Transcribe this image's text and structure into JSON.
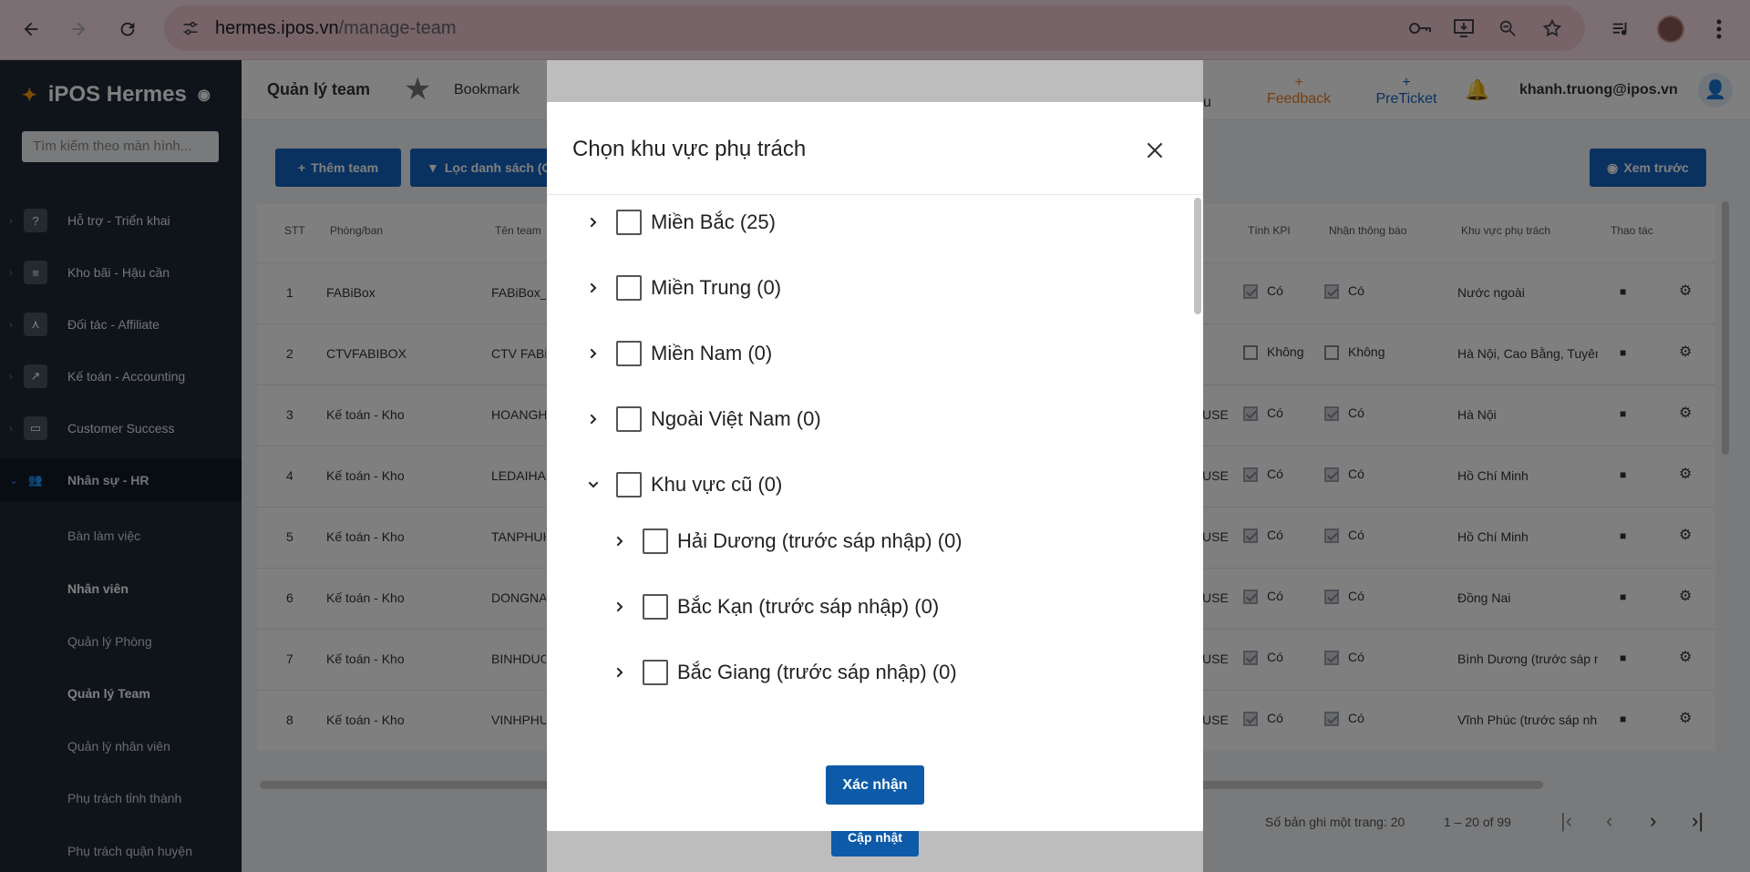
{
  "browser": {
    "url_host": "hermes.ipos.vn",
    "url_path": "/manage-team"
  },
  "sidebar": {
    "brand": "iPOS Hermes",
    "search_placeholder": "Tìm kiếm theo màn hình...",
    "items": [
      {
        "label": "Hỗ trợ - Triển khai",
        "icon": "question-icon"
      },
      {
        "label": "Kho bãi - Hậu cần",
        "icon": "warehouse-icon"
      },
      {
        "label": "Đối tác - Affiliate",
        "icon": "network-icon"
      },
      {
        "label": "Kế toán - Accounting",
        "icon": "chart-icon"
      },
      {
        "label": "Customer Success",
        "icon": "monitor-icon"
      },
      {
        "label": "Nhân sự - HR",
        "icon": "people-icon"
      }
    ],
    "sub": [
      "Bàn làm việc",
      "Nhân viên",
      "Quản lý Phòng",
      "Quản lý Team",
      "Quản lý nhân viên",
      "Phụ trách tỉnh thành",
      "Phụ trách quận huyện"
    ]
  },
  "header": {
    "page_title": "Quản lý team",
    "bookmark": "Bookmark",
    "feedback": "Feedback",
    "peticket": "PreTicket",
    "user": "khanh.truong@ipos.vn",
    "cut_text": "u"
  },
  "toolbar": {
    "add": "Thêm team",
    "filter": "Lọc danh sách (C",
    "preview": "Xem trước"
  },
  "table": {
    "headers": [
      "STT",
      "Phòng/ban",
      "Tên team",
      "Tính KPI",
      "Nhận thông báo",
      "Khu vực phụ trách",
      "Thao tác"
    ],
    "rows": [
      {
        "stt": "1",
        "dept": "FABiBox",
        "team": "FABiBox_",
        "kpi": "Có",
        "notify": "Có",
        "region": "Nước ngoài",
        "cut": ""
      },
      {
        "stt": "2",
        "dept": "CTVFABIBOX",
        "team": "CTV FABi",
        "kpi": "Không",
        "notify": "Không",
        "region": "Hà Nội, Cao Bằng, Tuyên",
        "cut": ""
      },
      {
        "stt": "3",
        "dept": "Kế toán - Kho",
        "team": "HOANGHO",
        "kpi": "Có",
        "notify": "Có",
        "region": "Hà Nội",
        "cut": "USE"
      },
      {
        "stt": "4",
        "dept": "Kế toán - Kho",
        "team": "LEDAIHAN",
        "kpi": "Có",
        "notify": "Có",
        "region": "Hồ Chí Minh",
        "cut": "USE"
      },
      {
        "stt": "5",
        "dept": "Kế toán - Kho",
        "team": "TANPHUH",
        "kpi": "Có",
        "notify": "Có",
        "region": "Hồ Chí Minh",
        "cut": "USE"
      },
      {
        "stt": "6",
        "dept": "Kế toán - Kho",
        "team": "DONGNAI",
        "kpi": "Có",
        "notify": "Có",
        "region": "Đồng Nai",
        "cut": "USE"
      },
      {
        "stt": "7",
        "dept": "Kế toán - Kho",
        "team": "BINHDUO",
        "kpi": "Có",
        "notify": "Có",
        "region": "Bình Dương (trước sáp n",
        "cut": "USE"
      },
      {
        "stt": "8",
        "dept": "Kế toán - Kho",
        "team": "VINHPHU",
        "kpi": "Có",
        "notify": "Có",
        "region": "Vĩnh Phúc (trước sáp nh",
        "cut": "USE"
      }
    ]
  },
  "pagination": {
    "per_page": "Số bản ghi một trang: 20",
    "range": "1 – 20 of 99"
  },
  "dialog": {
    "title": "Chọn khu vực phụ trách",
    "nodes": [
      {
        "label": "Miền Bắc (25)",
        "level": 0,
        "expanded": false
      },
      {
        "label": "Miền Trung (0)",
        "level": 0,
        "expanded": false
      },
      {
        "label": "Miền Nam (0)",
        "level": 0,
        "expanded": false
      },
      {
        "label": "Ngoài Việt Nam (0)",
        "level": 0,
        "expanded": false
      },
      {
        "label": "Khu vực cũ (0)",
        "level": 0,
        "expanded": true
      },
      {
        "label": "Hải Dương (trước sáp nhập) (0)",
        "level": 1,
        "expanded": false
      },
      {
        "label": "Bắc Kạn (trước sáp nhập) (0)",
        "level": 1,
        "expanded": false
      },
      {
        "label": "Bắc Giang (trước sáp nhập) (0)",
        "level": 1,
        "expanded": false
      }
    ],
    "confirm": "Xác nhận"
  },
  "update_button": "Cập nhật"
}
